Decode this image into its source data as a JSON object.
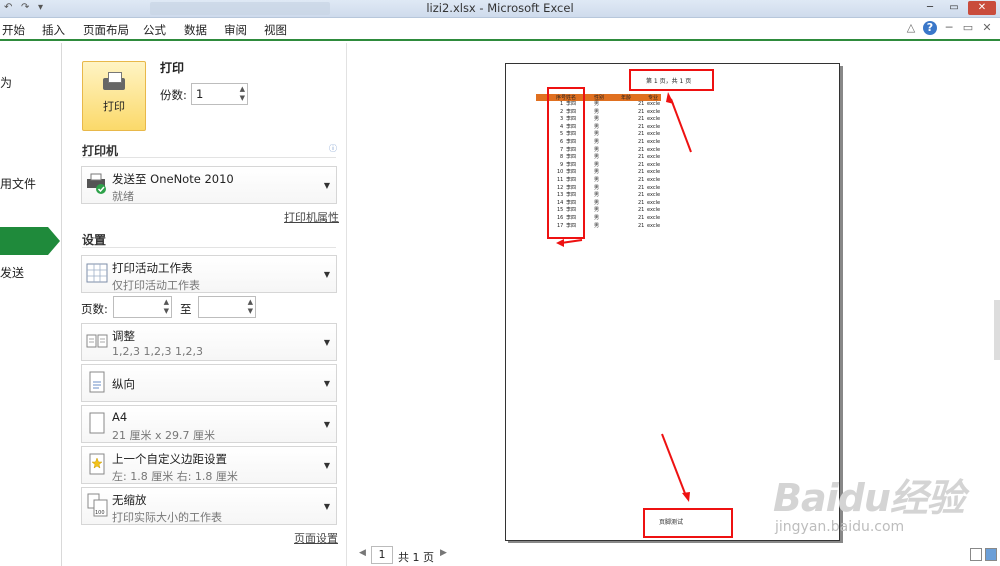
{
  "window": {
    "title": "lizi2.xlsx - Microsoft Excel"
  },
  "ribbon": {
    "tabs": [
      "开始",
      "插入",
      "页面布局",
      "公式",
      "数据",
      "审阅",
      "视图"
    ]
  },
  "left_nav": {
    "items": [
      "为",
      "用文件",
      "",
      "发送"
    ]
  },
  "print": {
    "button_label": "打印",
    "title": "打印",
    "copies_label": "份数:",
    "copies_value": "1"
  },
  "printer": {
    "section_label": "打印机",
    "name": "发送至 OneNote 2010",
    "status": "就绪",
    "properties_link": "打印机属性"
  },
  "settings": {
    "section_label": "设置",
    "what_to_print": {
      "title": "打印活动工作表",
      "sub": "仅打印活动工作表"
    },
    "pages_label": "页数:",
    "to_label": "至",
    "collate": {
      "title": "调整",
      "sub": "1,2,3    1,2,3    1,2,3"
    },
    "orientation": {
      "title": "纵向"
    },
    "paper": {
      "title": "A4",
      "sub": "21 厘米 x 29.7 厘米"
    },
    "margins": {
      "title": "上一个自定义边距设置",
      "sub": "左: 1.8 厘米    右: 1.8 厘米"
    },
    "scaling": {
      "title": "无缩放",
      "sub": "打印实际大小的工作表"
    },
    "page_setup_link": "页面设置"
  },
  "preview": {
    "header_text": "第 1 页，共 1 页",
    "footer_text": "页脚测试",
    "table_header": [
      "序号",
      "姓名",
      "性别",
      "年龄",
      "专业"
    ],
    "rows": [
      [
        "1",
        "李四",
        "男",
        "",
        "21",
        "excle"
      ],
      [
        "2",
        "李四",
        "男",
        "",
        "21",
        "excle"
      ],
      [
        "3",
        "李四",
        "男",
        "",
        "21",
        "excle"
      ],
      [
        "4",
        "李四",
        "男",
        "",
        "21",
        "excle"
      ],
      [
        "5",
        "李四",
        "男",
        "",
        "21",
        "excle"
      ],
      [
        "6",
        "李四",
        "男",
        "",
        "21",
        "excle"
      ],
      [
        "7",
        "李四",
        "男",
        "",
        "21",
        "excle"
      ],
      [
        "8",
        "李四",
        "男",
        "",
        "21",
        "excle"
      ],
      [
        "9",
        "李四",
        "男",
        "",
        "21",
        "excle"
      ],
      [
        "10",
        "李四",
        "男",
        "",
        "21",
        "excle"
      ],
      [
        "11",
        "李四",
        "男",
        "",
        "21",
        "excle"
      ],
      [
        "12",
        "李四",
        "男",
        "",
        "21",
        "excle"
      ],
      [
        "13",
        "李四",
        "男",
        "",
        "21",
        "excle"
      ],
      [
        "14",
        "李四",
        "男",
        "",
        "21",
        "excle"
      ],
      [
        "15",
        "李四",
        "男",
        "",
        "21",
        "excle"
      ],
      [
        "16",
        "李四",
        "男",
        "",
        "21",
        "excle"
      ],
      [
        "17",
        "李四",
        "男",
        "",
        "21",
        "excle"
      ]
    ]
  },
  "page_nav": {
    "current": "1",
    "total": "共 1 页"
  },
  "watermark": {
    "brand": "Baidu经验",
    "url": "jingyan.baidu.com"
  },
  "colors": {
    "accent": "#1f8a3b",
    "header_fill": "#e07020",
    "annotation": "#ee1111"
  }
}
